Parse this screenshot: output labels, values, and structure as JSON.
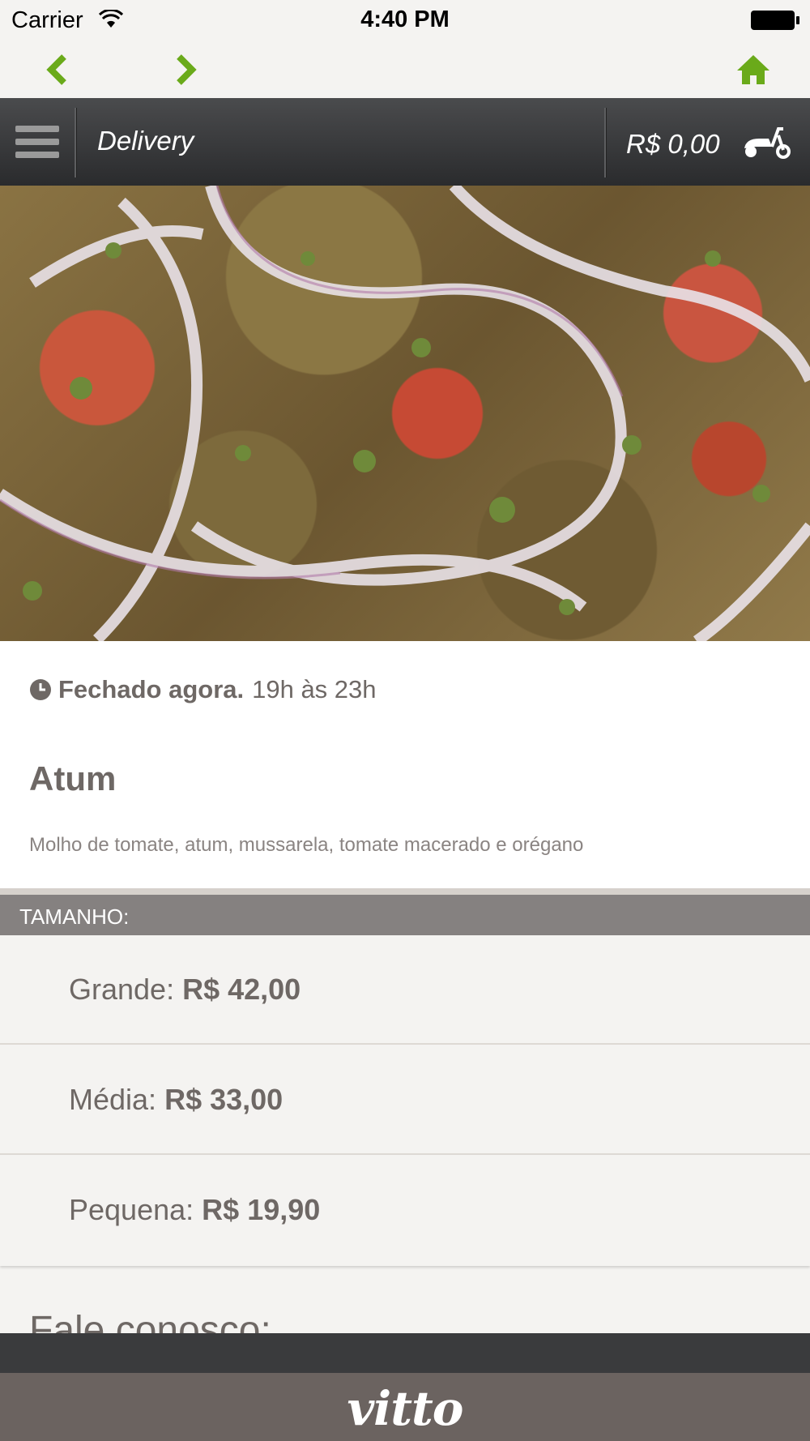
{
  "status_bar": {
    "carrier": "Carrier",
    "time": "4:40 PM"
  },
  "nav": {
    "back_icon": "chevron-left-icon",
    "forward_icon": "chevron-right-icon",
    "home_icon": "home-icon",
    "accent": "#6aaa1a"
  },
  "header": {
    "title": "Delivery",
    "cart_total": "R$ 0,00"
  },
  "hours": {
    "status": "Fechado agora.",
    "range": "19h às 23h"
  },
  "product": {
    "name": "Atum",
    "description": "Molho de tomate, atum, mussarela, tomate macerado e orégano"
  },
  "sizes": {
    "header": "TAMANHO:",
    "options": [
      {
        "label": "Grande:",
        "price": "R$ 42,00"
      },
      {
        "label": "Média:",
        "price": "R$ 33,00"
      },
      {
        "label": "Pequena:",
        "price": "R$ 19,90"
      }
    ]
  },
  "partial_heading": "Fale conosco:",
  "footer": {
    "brand": "vitto"
  }
}
